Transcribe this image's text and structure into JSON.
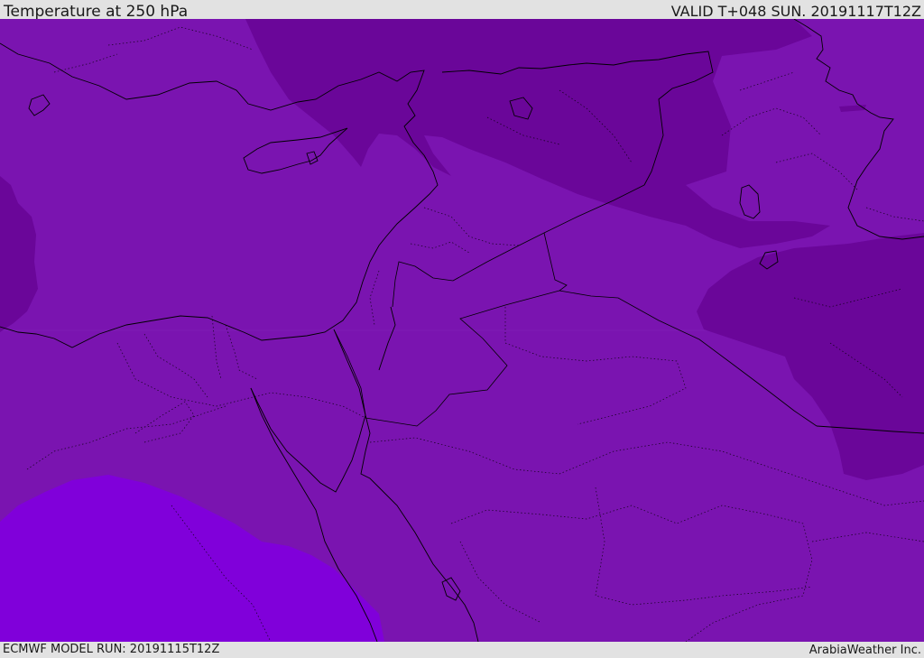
{
  "header": {
    "title": "Temperature at 250 hPa",
    "valid": "VALID T+048 SUN. 20191117T12Z"
  },
  "footer": {
    "model_run": "ECMWF MODEL RUN: 20191115T12Z",
    "credit": "ArabiaWeather Inc."
  },
  "colors": {
    "base_fill": "#7a14b0",
    "cold_fill": "#6a0699",
    "warm_fill": "#8000da",
    "bar_bg": "#e2e2e2",
    "coast_line": "#000000"
  }
}
